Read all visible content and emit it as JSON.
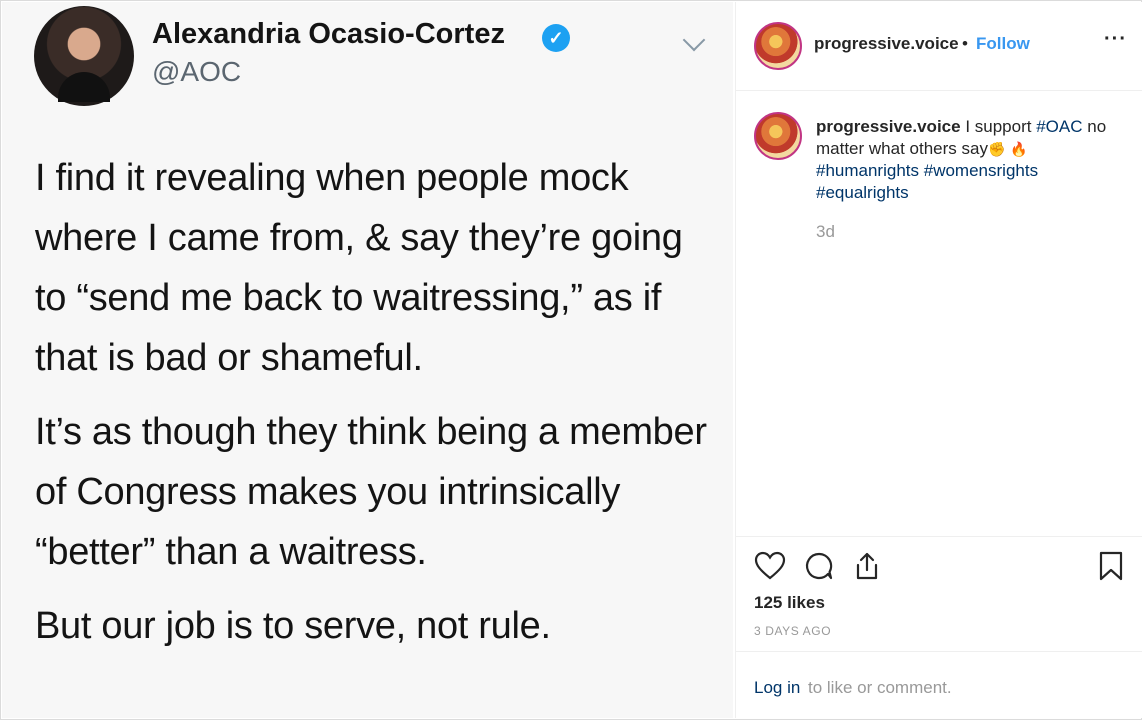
{
  "tweet": {
    "author_name": "Alexandria Ocasio-Cortez",
    "verified_mark": "✓",
    "handle": "@AOC",
    "paragraphs": [
      "I find it revealing when people mock where I came from, & say they’re going to “send me back to waitressing,” as if that is bad or shameful.",
      "It’s as though they think being a member of Congress makes you intrinsically “better” than a waitress.",
      "But our job is to serve, not rule."
    ]
  },
  "post": {
    "username": "progressive.voice",
    "separator": "•",
    "follow_label": "Follow",
    "more_label": "···",
    "caption": {
      "username": "progressive.voice",
      "text_before": "I support",
      "tag_1": "#OAC",
      "text_after": "no matter what others say",
      "emoji_1": "✊",
      "emoji_2": "🔥",
      "tag_2": "#humanrights",
      "tag_3": "#womensrights",
      "tag_4": "#equalrights"
    },
    "time_relative": "3d",
    "likes_text": "125 likes",
    "time_ago": "3 DAYS AGO",
    "login_link": "Log in",
    "login_rest": "to like or comment."
  },
  "colors": {
    "accent_blue": "#3897f0",
    "hashtag_blue": "#003569",
    "twitter_blue": "#1da1f2"
  },
  "icons": [
    "verified-icon",
    "chevron-down-icon",
    "more-icon",
    "heart-icon",
    "comment-icon",
    "share-icon",
    "bookmark-icon"
  ]
}
